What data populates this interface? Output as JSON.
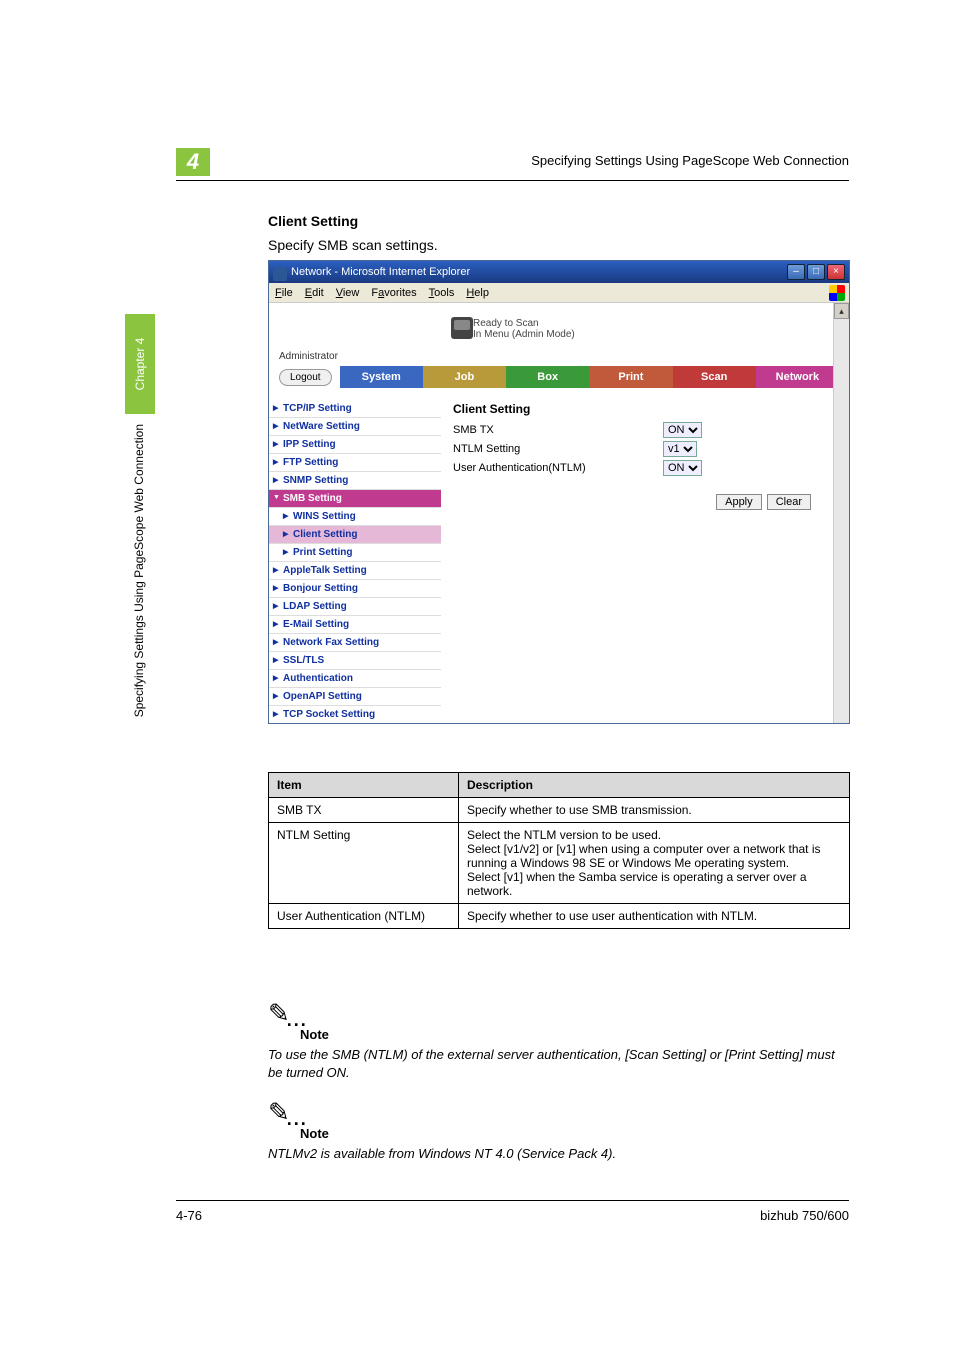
{
  "page": {
    "chapter_num": "4",
    "header_right": "Specifying Settings Using PageScope Web Connection",
    "footer_left": "4-76",
    "footer_right": "bizhub 750/600",
    "side_chapter": "Chapter 4",
    "side_long": "Specifying Settings Using PageScope Web Connection"
  },
  "section": {
    "title": "Client Setting",
    "subtitle": "Specify SMB scan settings."
  },
  "ie": {
    "title": "Network - Microsoft Internet Explorer",
    "menu": [
      "File",
      "Edit",
      "View",
      "Favorites",
      "Tools",
      "Help"
    ],
    "banner_line1": "Ready to Scan",
    "banner_line2": "In Menu (Admin Mode)",
    "admin": "Administrator",
    "logout": "Logout",
    "tabs": {
      "system": "System",
      "job": "Job",
      "box": "Box",
      "print": "Print",
      "scan": "Scan",
      "network": "Network"
    },
    "sidebar": [
      {
        "label": "TCP/IP Setting"
      },
      {
        "label": "NetWare Setting"
      },
      {
        "label": "IPP Setting"
      },
      {
        "label": "FTP Setting"
      },
      {
        "label": "SNMP Setting"
      },
      {
        "label": "SMB Setting",
        "sel": true
      },
      {
        "label": "WINS Setting",
        "sub": true
      },
      {
        "label": "Client Setting",
        "sub": true,
        "active": true
      },
      {
        "label": "Print Setting",
        "sub": true
      },
      {
        "label": "AppleTalk Setting"
      },
      {
        "label": "Bonjour Setting"
      },
      {
        "label": "LDAP Setting"
      },
      {
        "label": "E-Mail Setting"
      },
      {
        "label": "Network Fax Setting"
      },
      {
        "label": "SSL/TLS"
      },
      {
        "label": "Authentication"
      },
      {
        "label": "OpenAPI Setting"
      },
      {
        "label": "TCP Socket Setting"
      }
    ],
    "form": {
      "heading": "Client Setting",
      "rows": [
        {
          "label": "SMB TX",
          "value": "ON"
        },
        {
          "label": "NTLM Setting",
          "value": "v1"
        },
        {
          "label": "User Authentication(NTLM)",
          "value": "ON"
        }
      ],
      "apply": "Apply",
      "clear": "Clear"
    }
  },
  "desc_table": {
    "head": {
      "item": "Item",
      "desc": "Description"
    },
    "rows": [
      {
        "item": "SMB TX",
        "desc": "Specify whether to use SMB transmission."
      },
      {
        "item": "NTLM Setting",
        "desc": "Select the NTLM version to be used.\nSelect [v1/v2] or [v1] when using a computer over a network that is running a Windows 98 SE or Windows Me operating system.\nSelect [v1] when the Samba service is operating a server over a network."
      },
      {
        "item": "User Authentication (NTLM)",
        "desc": "Specify whether to use user authentication with NTLM."
      }
    ]
  },
  "notes": {
    "label": "Note",
    "n1": "To use the SMB (NTLM) of the external server authentication, [Scan Setting] or [Print Setting] must be turned ON.",
    "n2": "NTLMv2 is available from Windows NT 4.0 (Service Pack 4)."
  }
}
